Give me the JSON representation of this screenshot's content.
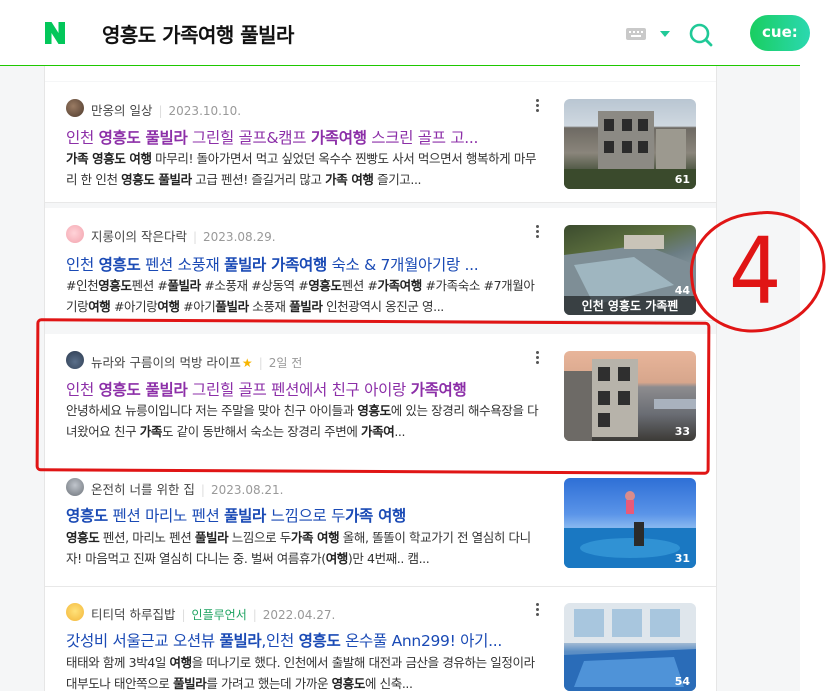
{
  "header": {
    "logo_letter": "N",
    "query": "영흥도 가족여행 풀빌라",
    "cue_label": "cue:",
    "brand_color": "#03c75a"
  },
  "annotation": {
    "number": "4",
    "color": "#e01515"
  },
  "results": [
    {
      "author": "만옹의 일상",
      "date": "2023.10.10.",
      "title": [
        "인천 ",
        "영흥도 풀빌라",
        " 그린힐 골프&캠프 ",
        "가족여행",
        " 스크린 골프 고..."
      ],
      "visited": true,
      "desc": [
        "",
        "가족 영흥도 여행",
        " 마무리! 돌아가면서 먹고 싶었던 옥수수 찐빵도 사서 먹으면서 행복하게 마무리 한 인천 ",
        "영흥도 풀빌라",
        " 고급 펜션! 즐길거리 많고 ",
        "가족 여행",
        " 즐기고..."
      ],
      "thumb_count": "61",
      "thumb_caption": ""
    },
    {
      "author": "지롱이의 작은다락",
      "date": "2023.08.29.",
      "title": [
        "인천 ",
        "영흥도",
        " 펜션 소풍재 ",
        "풀빌라 가족여행",
        " 숙소 & 7개월아기랑 ..."
      ],
      "visited": false,
      "desc": [
        "#인천",
        "영흥도",
        "펜션 #",
        "풀빌라",
        " #소풍재 #상동역 #",
        "영흥도",
        "펜션 #",
        "가족여행",
        " #가족숙소 #7개월아기랑",
        "여행",
        " #아기랑",
        "여행",
        " #아기",
        "풀빌라",
        " 소풍재 ",
        "풀빌라",
        " 인천광역시 옹진군 영..."
      ],
      "thumb_count": "44",
      "thumb_caption": "인천 영흥도 가족펜"
    },
    {
      "author": "뉴라와 구름이의 먹방 라이프",
      "date": "2일 전",
      "title": [
        "인천 ",
        "영흥도 풀빌라",
        " 그린힐 골프 펜션에서 친구 아이랑 ",
        "가족여행",
        ""
      ],
      "visited": true,
      "desc": [
        "안녕하세요 뉴릉이입니다 저는 주말을 맞아 친구 아이들과 ",
        "영흥도",
        "에 있는 장경리 해수욕장을 다녀왔어요 친구 ",
        "가족",
        "도 같이 동반해서 숙소는 장경리 주변에 ",
        "가족여",
        "..."
      ],
      "thumb_count": "33",
      "thumb_caption": ""
    },
    {
      "author": "온전히 너를 위한 집",
      "date": "2023.08.21.",
      "title": [
        "",
        "영흥도",
        " 펜션 마리노 펜션 ",
        "풀빌라",
        " 느낌으로 두",
        "가족 여행",
        ""
      ],
      "visited": false,
      "desc": [
        "",
        "영흥도",
        " 펜션, 마리노 펜션 ",
        "풀빌라",
        " 느낌으로 두",
        "가족 여행",
        " 올해, 똘똘이 학교가기 전 열심히 다니자! 마음먹고 진짜 열심히 다니는 중. 벌써 여름휴가(",
        "여행",
        ")만 4번째.. 캠..."
      ],
      "thumb_count": "31",
      "thumb_caption": ""
    },
    {
      "author": "티티덕 하루집밥",
      "influencer": "인플루언서",
      "date": "2022.04.27.",
      "title": [
        "갓성비 서울근교 오션뷰 ",
        "풀빌라",
        ",인천 ",
        "영흥도",
        " 온수풀 Ann299! 아기..."
      ],
      "visited": false,
      "desc": [
        "태태와 함께 3박4일 ",
        "여행",
        "을 떠나기로 했다. 인천에서 출발해 대전과 금산을 경유하는 일정이라 대부도나 태안쪽으로 ",
        "풀빌라",
        "를 가려고 했는데 가까운 ",
        "영흥도",
        "에 신축..."
      ],
      "thumb_count": "54",
      "thumb_caption": ""
    }
  ]
}
